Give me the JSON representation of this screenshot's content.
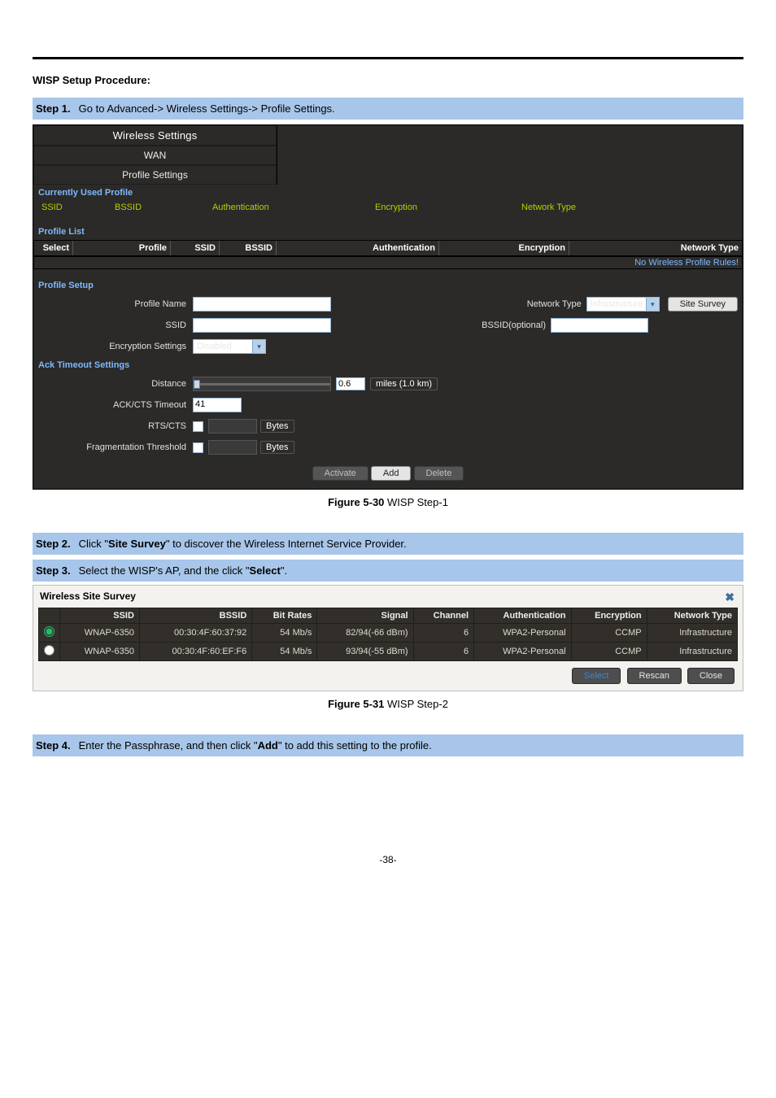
{
  "section_title": "WISP Setup Procedure:",
  "steps": {
    "s1": {
      "num": "Step 1.",
      "text_a": "Go to Advanced-> Wireless Settings-> Profile Settings."
    },
    "s2": {
      "num": "Step 2.",
      "prefix": "Click \"",
      "bold": "Site Survey",
      "suffix": "\" to discover the Wireless Internet Service Provider."
    },
    "s3": {
      "num": "Step 3.",
      "prefix": "Select the WISP's AP, and the click \"",
      "bold": "Select",
      "suffix": "\"."
    },
    "s4": {
      "num": "Step 4.",
      "prefix": "Enter the Passphrase, and then click \"",
      "bold": "Add",
      "suffix": "\" to add this setting to the profile."
    }
  },
  "panel1": {
    "tabs": {
      "t1": "Wireless Settings",
      "t2": "WAN",
      "t3": "Profile Settings"
    },
    "cur_used": "Currently Used Profile",
    "greencols": {
      "ssid": "SSID",
      "bssid": "BSSID",
      "auth": "Authentication",
      "enc": "Encryption",
      "net": "Network Type"
    },
    "profile_list": "Profile List",
    "listcols": {
      "select": "Select",
      "profile": "Profile",
      "ssid": "SSID",
      "bssid": "BSSID",
      "auth": "Authentication",
      "enc": "Encryption",
      "net": "Network Type"
    },
    "no_rules": "No Wireless Profile Rules!",
    "profile_setup": "Profile Setup",
    "labels": {
      "profile_name": "Profile Name",
      "network_type": "Network Type",
      "network_type_val": "Infrastructure",
      "site_survey": "Site Survey",
      "ssid": "SSID",
      "bssid_opt": "BSSID(optional)",
      "enc_settings": "Encryption Settings",
      "enc_settings_val": "Disabled",
      "ack_section": "Ack Timeout Settings",
      "distance": "Distance",
      "distance_val": "0.6",
      "distance_unit": "miles (1.0 km)",
      "ackcts": "ACK/CTS Timeout",
      "ackcts_val": "41",
      "rtscts": "RTS/CTS",
      "bytes": "Bytes",
      "frag": "Fragmentation Threshold",
      "btn_activate": "Activate",
      "btn_add": "Add",
      "btn_delete": "Delete"
    }
  },
  "fig1": {
    "b": "Figure 5-30",
    "t": " WISP Step-1"
  },
  "survey": {
    "title": "Wireless Site Survey",
    "close": "✖",
    "cols": {
      "ssid": "SSID",
      "bssid": "BSSID",
      "bit": "Bit Rates",
      "signal": "Signal",
      "chan": "Channel",
      "auth": "Authentication",
      "enc": "Encryption",
      "net": "Network Type"
    },
    "rows": [
      {
        "ssid": "WNAP-6350",
        "bssid": "00:30:4F:60:37:92",
        "bit": "54 Mb/s",
        "signal": "82/94(-66 dBm)",
        "chan": "6",
        "auth": "WPA2-Personal",
        "enc": "CCMP",
        "net": "Infrastructure"
      },
      {
        "ssid": "WNAP-6350",
        "bssid": "00:30:4F:60:EF:F6",
        "bit": "54 Mb/s",
        "signal": "93/94(-55 dBm)",
        "chan": "6",
        "auth": "WPA2-Personal",
        "enc": "CCMP",
        "net": "Infrastructure"
      }
    ],
    "btn_select": "Select",
    "btn_rescan": "Rescan",
    "btn_close": "Close"
  },
  "fig2": {
    "b": "Figure 5-31",
    "t": " WISP Step-2"
  },
  "page": "-38-"
}
